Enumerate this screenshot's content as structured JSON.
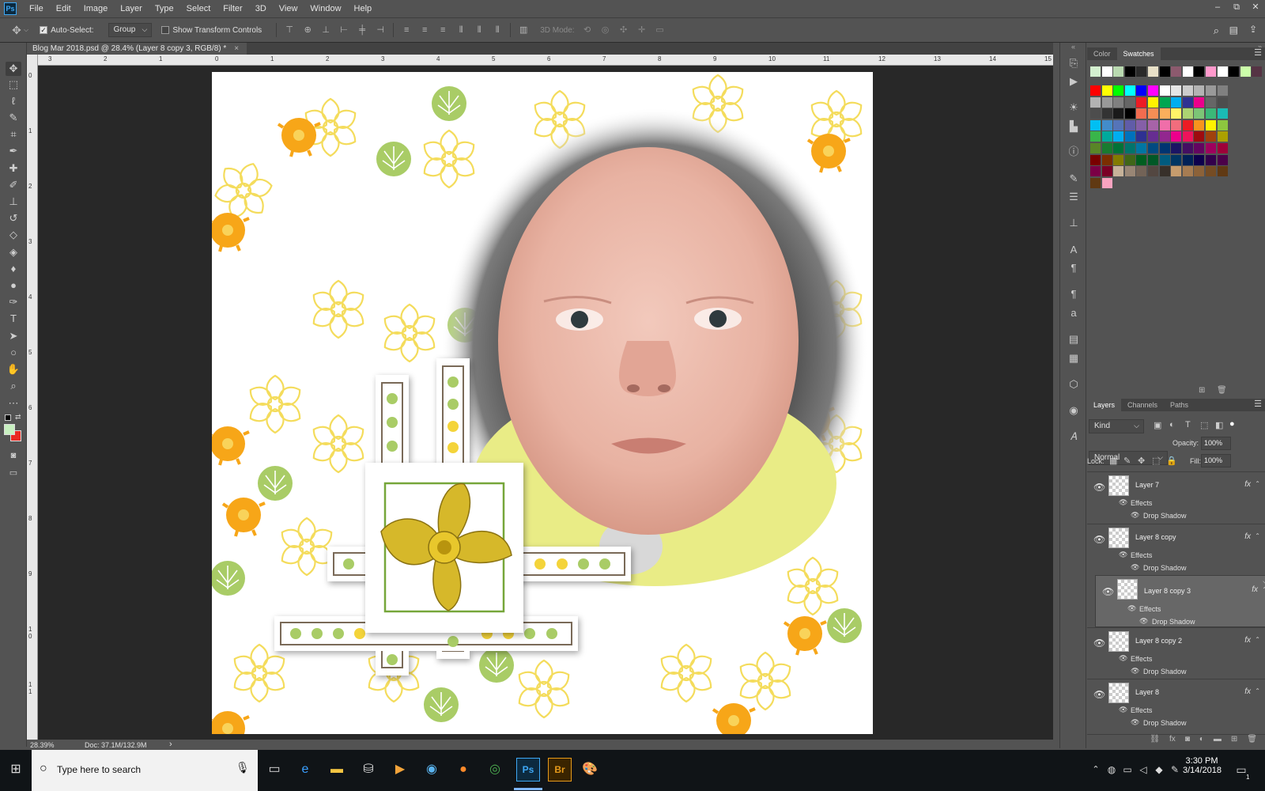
{
  "app": {
    "logo": "Ps"
  },
  "menu": [
    "File",
    "Edit",
    "Image",
    "Layer",
    "Type",
    "Select",
    "Filter",
    "3D",
    "View",
    "Window",
    "Help"
  ],
  "window_controls": {
    "minimize": "–",
    "restore": "⧉",
    "close": "✕"
  },
  "options": {
    "auto_select_label": "Auto-Select:",
    "auto_select_value": "Group",
    "show_transform_label": "Show Transform Controls",
    "mode_3d_label": "3D Mode:"
  },
  "document_tab": {
    "title": "Blog Mar 2018.psd @ 28.4% (Layer 8 copy 3, RGB/8) *",
    "close": "×"
  },
  "ruler": {
    "top": [
      "3",
      "2",
      "1",
      "0",
      "1",
      "2",
      "3",
      "4",
      "5",
      "6",
      "7",
      "8",
      "9",
      "10",
      "11",
      "12",
      "13",
      "14",
      "15"
    ],
    "left": [
      "0",
      "1",
      "2",
      "3",
      "4",
      "5",
      "6",
      "7",
      "8",
      "9",
      "1 0",
      "1 1"
    ]
  },
  "status": {
    "zoom": "28.39%",
    "doc": "Doc: 37.1M/132.9M",
    "arrow": "›"
  },
  "color_panel": {
    "tabs": [
      "Color",
      "Swatches"
    ],
    "active": "Swatches"
  },
  "swatches": {
    "recent": [
      "#d4f0d0",
      "#ffffff",
      "#b9d9b0",
      "#000000",
      "#2a2a2a",
      "#e8e0c8",
      "#000000",
      "#8c5a6e",
      "#ffffff",
      "#000000",
      "#ff99cc",
      "#ffffff",
      "#000000",
      "#ccffaa",
      "#553344"
    ],
    "rows": [
      [
        "#ff0000",
        "#ffff00",
        "#00ff00",
        "#00ffff",
        "#0000ff",
        "#ff00ff",
        "#ffffff",
        "#e6e6e6",
        "#cccccc",
        "#b3b3b3",
        "#999999",
        "#808080"
      ],
      [
        "#b3b3b3",
        "#999999",
        "#808080",
        "#666666",
        "#ed1c24",
        "#fff200",
        "#00a651",
        "#00aeef",
        "#2e3192",
        "#ec008c",
        "#666666",
        "#4d4d4d"
      ],
      [
        "#4d4d4d",
        "#333333",
        "#1a1a1a",
        "#000000",
        "#f26c4f",
        "#f68e55",
        "#fbaf5c",
        "#fff467",
        "#acd372",
        "#7cc576",
        "#3bb878",
        "#1abbb4"
      ],
      [
        "#00bff3",
        "#438cca",
        "#5574b9",
        "#605ca8",
        "#855fa8",
        "#a763a8",
        "#f06ea9",
        "#f26d7d",
        "#ed1c24",
        "#f7941d",
        "#fff200",
        "#8dc63f"
      ],
      [
        "#39b54a",
        "#00a99d",
        "#00aeef",
        "#0072bc",
        "#2e3192",
        "#662d91",
        "#92278f",
        "#ec008c",
        "#ed145b",
        "#9e0b0f",
        "#a0410d",
        "#aba000"
      ],
      [
        "#598527",
        "#197b30",
        "#007236",
        "#00746b",
        "#0076a3",
        "#004a80",
        "#003471",
        "#1b1464",
        "#440e62",
        "#630460",
        "#9e005d",
        "#9e0039"
      ],
      [
        "#790000",
        "#7b2e00",
        "#827b00",
        "#406618",
        "#005e20",
        "#005826",
        "#005b7f",
        "#003663",
        "#002157",
        "#0d004c",
        "#32004b",
        "#4b0049"
      ],
      [
        "#7b0046",
        "#7a0026",
        "#c7b299",
        "#998675",
        "#736357",
        "#534741",
        "#37302a",
        "#c69c6d",
        "#a67c52",
        "#8c6239",
        "#754c24",
        "#603913"
      ],
      [
        "#603913",
        "#f9a3c0"
      ]
    ]
  },
  "layers_panel": {
    "tabs": [
      "Layers",
      "Channels",
      "Paths"
    ],
    "active": "Layers",
    "kind_label": "Kind",
    "blend_mode": "Normal",
    "opacity_label": "Opacity:",
    "opacity_value": "100%",
    "lock_label": "Lock:",
    "fill_label": "Fill:",
    "fill_value": "100%",
    "layers": [
      {
        "name": "Layer 7",
        "fx": "fx",
        "effects": "Effects",
        "effect": "Drop Shadow",
        "selected": false
      },
      {
        "name": "Layer 8 copy",
        "fx": "fx",
        "effects": "Effects",
        "effect": "Drop Shadow",
        "selected": false
      },
      {
        "name": "Layer 8 copy 3",
        "fx": "fx",
        "effects": "Effects",
        "effect": "Drop Shadow",
        "selected": true
      },
      {
        "name": "Layer 8 copy 2",
        "fx": "fx",
        "effects": "Effects",
        "effect": "Drop Shadow",
        "selected": false
      },
      {
        "name": "Layer 8",
        "fx": "fx",
        "effects": "Effects",
        "effect": "Drop Shadow",
        "selected": false
      }
    ]
  },
  "taskbar": {
    "search_placeholder": "Type here to search",
    "time": "3:30 PM",
    "date": "3/14/2018",
    "ps_label": "Ps",
    "br_label": "Br",
    "notification_count": "1"
  }
}
